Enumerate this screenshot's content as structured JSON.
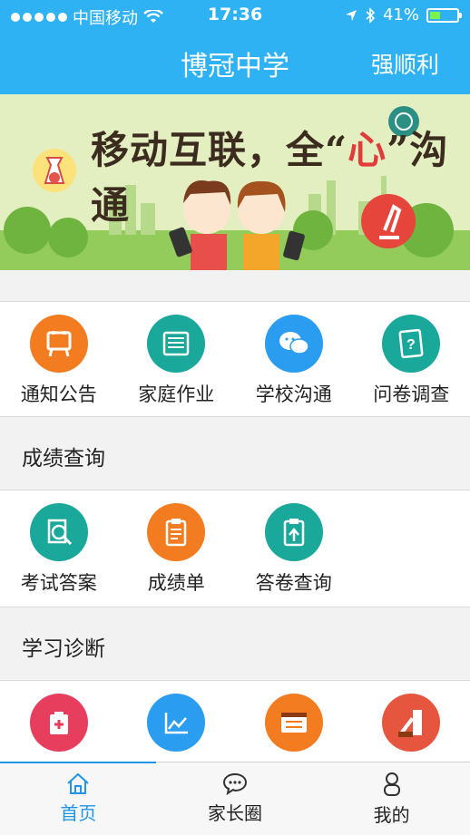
{
  "status_bar": {
    "carrier": "中国移动",
    "time": "17:36",
    "battery": "41%",
    "battery_level": 0.41
  },
  "header": {
    "title": "博冠中学",
    "user": "强顺利"
  },
  "banner": {
    "slogan_part1": "移动互联，全“",
    "slogan_heart": "心",
    "slogan_part2": "”沟通"
  },
  "colors": {
    "header_bg": "#2fb2f3",
    "orange": "#f47c20",
    "teal": "#1aa89a",
    "blue": "#2a9df0",
    "red": "#e83e5e",
    "tab_active": "#2196e6"
  },
  "grid1": [
    {
      "label": "通知公告",
      "icon": "notice-board-icon"
    },
    {
      "label": "家庭作业",
      "icon": "homework-icon"
    },
    {
      "label": "学校沟通",
      "icon": "chat-icon"
    },
    {
      "label": "问卷调查",
      "icon": "survey-icon"
    }
  ],
  "section1": {
    "title": "成绩查询"
  },
  "grid2": [
    {
      "label": "考试答案",
      "icon": "search-answer-icon"
    },
    {
      "label": "成绩单",
      "icon": "report-card-icon"
    },
    {
      "label": "答卷查询",
      "icon": "answer-sheet-icon"
    }
  ],
  "section2": {
    "title": "学习诊断"
  },
  "grid3": [
    {
      "icon": "medical-kit-icon"
    },
    {
      "icon": "line-chart-icon"
    },
    {
      "icon": "calculator-board-icon"
    },
    {
      "icon": "abc-pencil-icon"
    }
  ],
  "tabs": [
    {
      "label": "首页",
      "icon": "home-icon"
    },
    {
      "label": "家长圈",
      "icon": "chat-bubble-icon"
    },
    {
      "label": "我的",
      "icon": "person-icon"
    }
  ]
}
